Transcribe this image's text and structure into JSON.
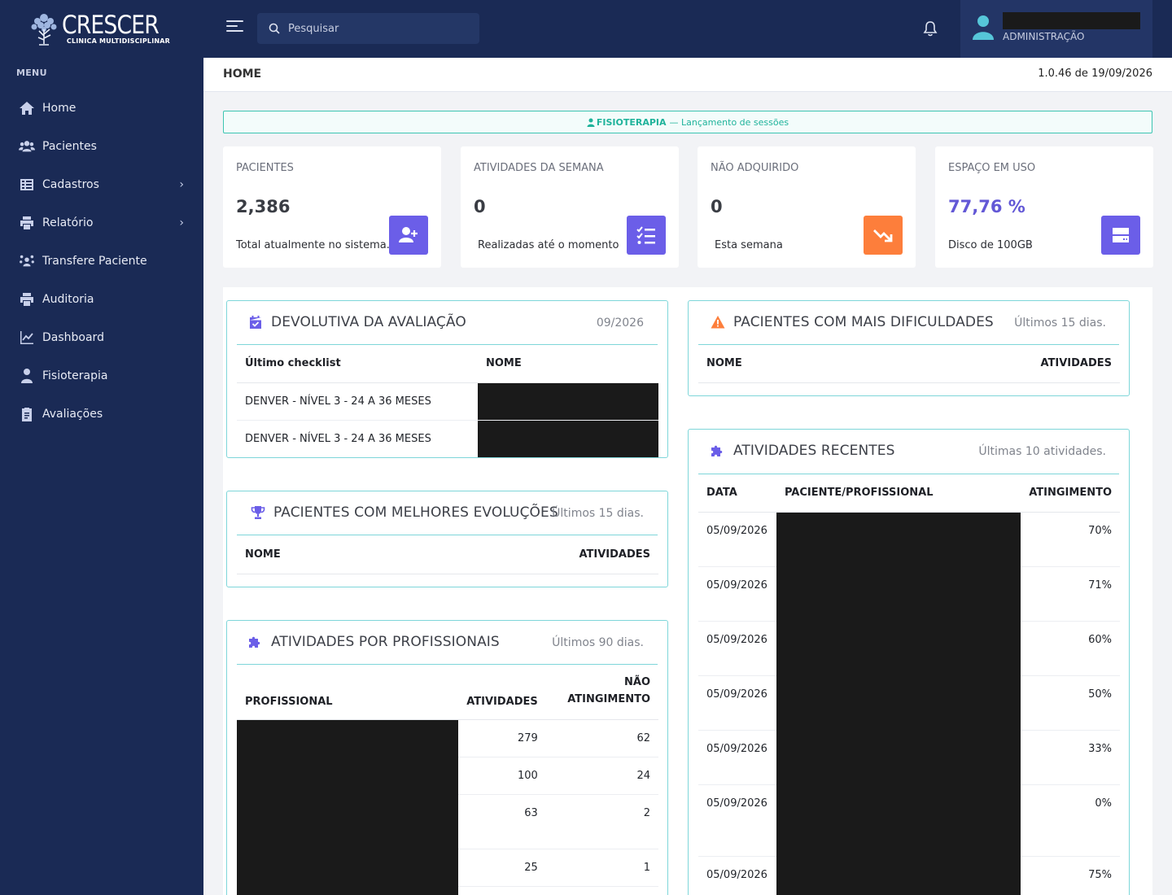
{
  "brand": {
    "name": "CRESCER",
    "subtitle": "CLINICA MULTIDISCIPLINAR"
  },
  "sidebar": {
    "menu_label": "MENU",
    "items": [
      {
        "label": "Home",
        "icon": "home-icon",
        "has_children": false
      },
      {
        "label": "Pacientes",
        "icon": "users-icon",
        "has_children": false
      },
      {
        "label": "Cadastros",
        "icon": "table-icon",
        "has_children": true
      },
      {
        "label": "Relatório",
        "icon": "printer-icon",
        "has_children": true
      },
      {
        "label": "Transfere Paciente",
        "icon": "people-transfer-icon",
        "has_children": false
      },
      {
        "label": "Auditoria",
        "icon": "printer-icon",
        "has_children": false
      },
      {
        "label": "Dashboard",
        "icon": "chart-line-icon",
        "has_children": false
      },
      {
        "label": "Fisioterapia",
        "icon": "user-medical-icon",
        "has_children": false
      },
      {
        "label": "Avaliações",
        "icon": "clipboard-icon",
        "has_children": false
      }
    ]
  },
  "topbar": {
    "search_placeholder": "Pesquisar",
    "user_role": "ADMINISTRAÇÃO"
  },
  "page": {
    "title": "HOME",
    "version": "1.0.46 de 19/09/2026"
  },
  "alert": {
    "strong": "FISIOTERAPIA",
    "text": " — Lançamento de sessões"
  },
  "stats": [
    {
      "label": "PACIENTES",
      "value": "2,386",
      "sub": "Total atualmente no sistema.",
      "icon": "user-plus-icon",
      "color": "#6b5ee8"
    },
    {
      "label": "ATIVIDADES DA SEMANA",
      "value": "0",
      "sub": "Realizadas até o momento",
      "icon": "list-check-icon",
      "color": "#6b5ee8"
    },
    {
      "label": "NÃO ADQUIRIDO",
      "value": "0",
      "sub": "Esta semana",
      "icon": "trend-down-icon",
      "color": "#fd7e3b"
    },
    {
      "label": "ESPAÇO EM USO",
      "value": "77,76 %",
      "sub": "Disco de 100GB",
      "icon": "hard-drive-icon",
      "color": "#6b5ee8"
    }
  ],
  "devolutiva": {
    "title": "DEVOLUTIVA DA AVALIAÇÃO",
    "subtitle": "09/2026",
    "columns": [
      "Último checklist",
      "NOME"
    ],
    "rows": [
      {
        "checklist": "DENVER - NÍVEL 3 - 24 A 36 MESES"
      },
      {
        "checklist": "DENVER - NÍVEL 3 - 24 A 36 MESES"
      }
    ]
  },
  "melhores": {
    "title": "PACIENTES COM MELHORES EVOLUÇÕES",
    "subtitle": "Últimos 15 dias.",
    "columns": [
      "NOME",
      "ATIVIDADES"
    ]
  },
  "profissionais": {
    "title": "ATIVIDADES POR PROFISSIONAIS",
    "subtitle": "Últimos 90 dias.",
    "columns": [
      "PROFISSIONAL",
      "ATIVIDADES",
      "NÃO ATINGIMENTO"
    ],
    "rows": [
      {
        "atividades": "279",
        "nao": "62"
      },
      {
        "atividades": "100",
        "nao": "24"
      },
      {
        "atividades": "63",
        "nao": "2"
      },
      {
        "atividades": "25",
        "nao": "1"
      }
    ]
  },
  "dificuldades": {
    "title": "PACIENTES COM MAIS DIFICULDADES",
    "subtitle": "Últimos 15 dias.",
    "columns": [
      "NOME",
      "ATIVIDADES"
    ]
  },
  "recentes": {
    "title": "ATIVIDADES RECENTES",
    "subtitle": "Últimas 10 atividades.",
    "columns": [
      "DATA",
      "PACIENTE/PROFISSIONAL",
      "ATINGIMENTO"
    ],
    "rows": [
      {
        "data": "05/09/2026",
        "pct": "70%"
      },
      {
        "data": "05/09/2026",
        "pct": "71%"
      },
      {
        "data": "05/09/2026",
        "pct": "60%"
      },
      {
        "data": "05/09/2026",
        "pct": "50%"
      },
      {
        "data": "05/09/2026",
        "pct": "33%"
      },
      {
        "data": "05/09/2026",
        "pct": "0%"
      },
      {
        "data": "05/09/2026",
        "pct": "75%"
      }
    ]
  }
}
